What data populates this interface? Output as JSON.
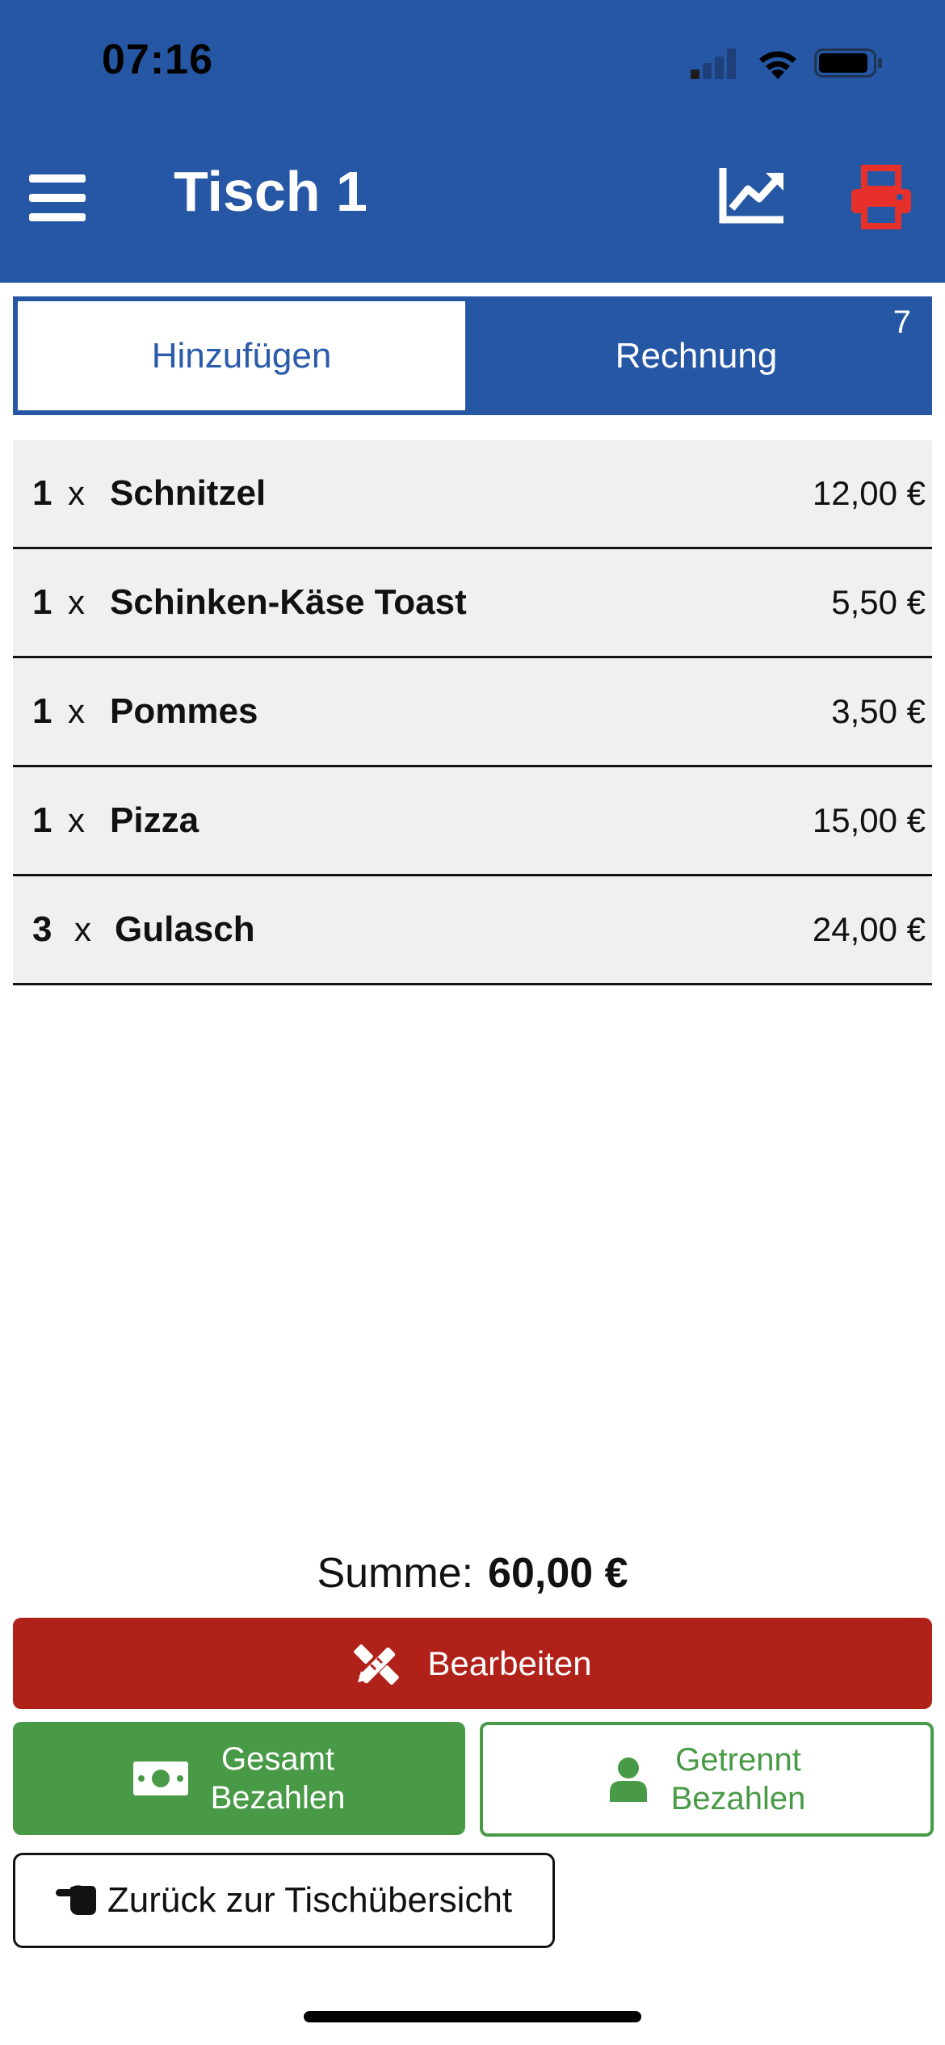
{
  "status_bar": {
    "time": "07:16"
  },
  "header": {
    "title": "Tisch 1",
    "background": "#2657a5",
    "print_color": "#e8302a",
    "icons": [
      "menu-icon",
      "chart-line-icon",
      "printer-icon"
    ]
  },
  "tabs": {
    "add_label": "Hinzufügen",
    "bill_label": "Rechnung",
    "bill_badge": "7"
  },
  "orders": [
    {
      "qty": "1",
      "x": "x",
      "name": "Schnitzel",
      "price": "12,00 €"
    },
    {
      "qty": "1",
      "x": "x",
      "name": "Schinken-Käse Toast",
      "price": "5,50 €"
    },
    {
      "qty": "1",
      "x": "x",
      "name": "Pommes",
      "price": "3,50 €"
    },
    {
      "qty": "1",
      "x": "x",
      "name": "Pizza",
      "price": "15,00 €"
    },
    {
      "qty": "3",
      "x": "x",
      "name": "Gulasch",
      "price": "24,00 €"
    }
  ],
  "summary": {
    "label": "Summe:",
    "value": "60,00 €"
  },
  "actions": {
    "edit_label": "Bearbeiten",
    "edit_color": "#b0211a",
    "total_line1": "Gesamt",
    "total_line2": "Bezahlen",
    "split_line1": "Getrennt",
    "split_line2": "Bezahlen",
    "pay_color": "#489a46",
    "back_label": "Zurück zur Tischübersicht"
  }
}
